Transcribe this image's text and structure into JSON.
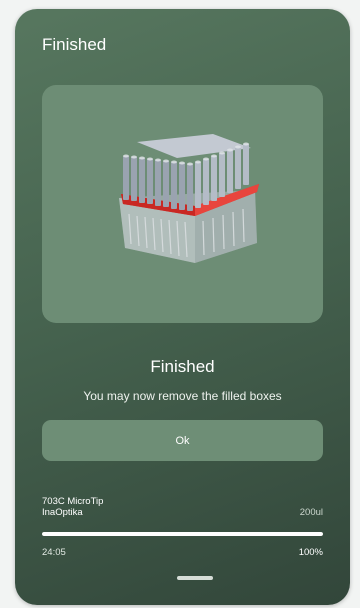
{
  "header": {
    "title": "Finished"
  },
  "illustration": {
    "icon": "pipette-tip-rack-image",
    "accent_color": "#e0332c"
  },
  "status": {
    "title": "Finished",
    "message": "You may now remove the filled boxes"
  },
  "actions": {
    "ok_label": "Ok"
  },
  "job": {
    "product_name": "703C MicroTip",
    "brand": "InaOptika",
    "volume": "200ul",
    "elapsed_time": "24:05",
    "progress_label": "100%",
    "progress_fraction": 1.0
  },
  "colors": {
    "background_top": "#57775f",
    "background_bottom": "#32463a",
    "card": "#6d8d75",
    "button": "#6e8e76"
  }
}
